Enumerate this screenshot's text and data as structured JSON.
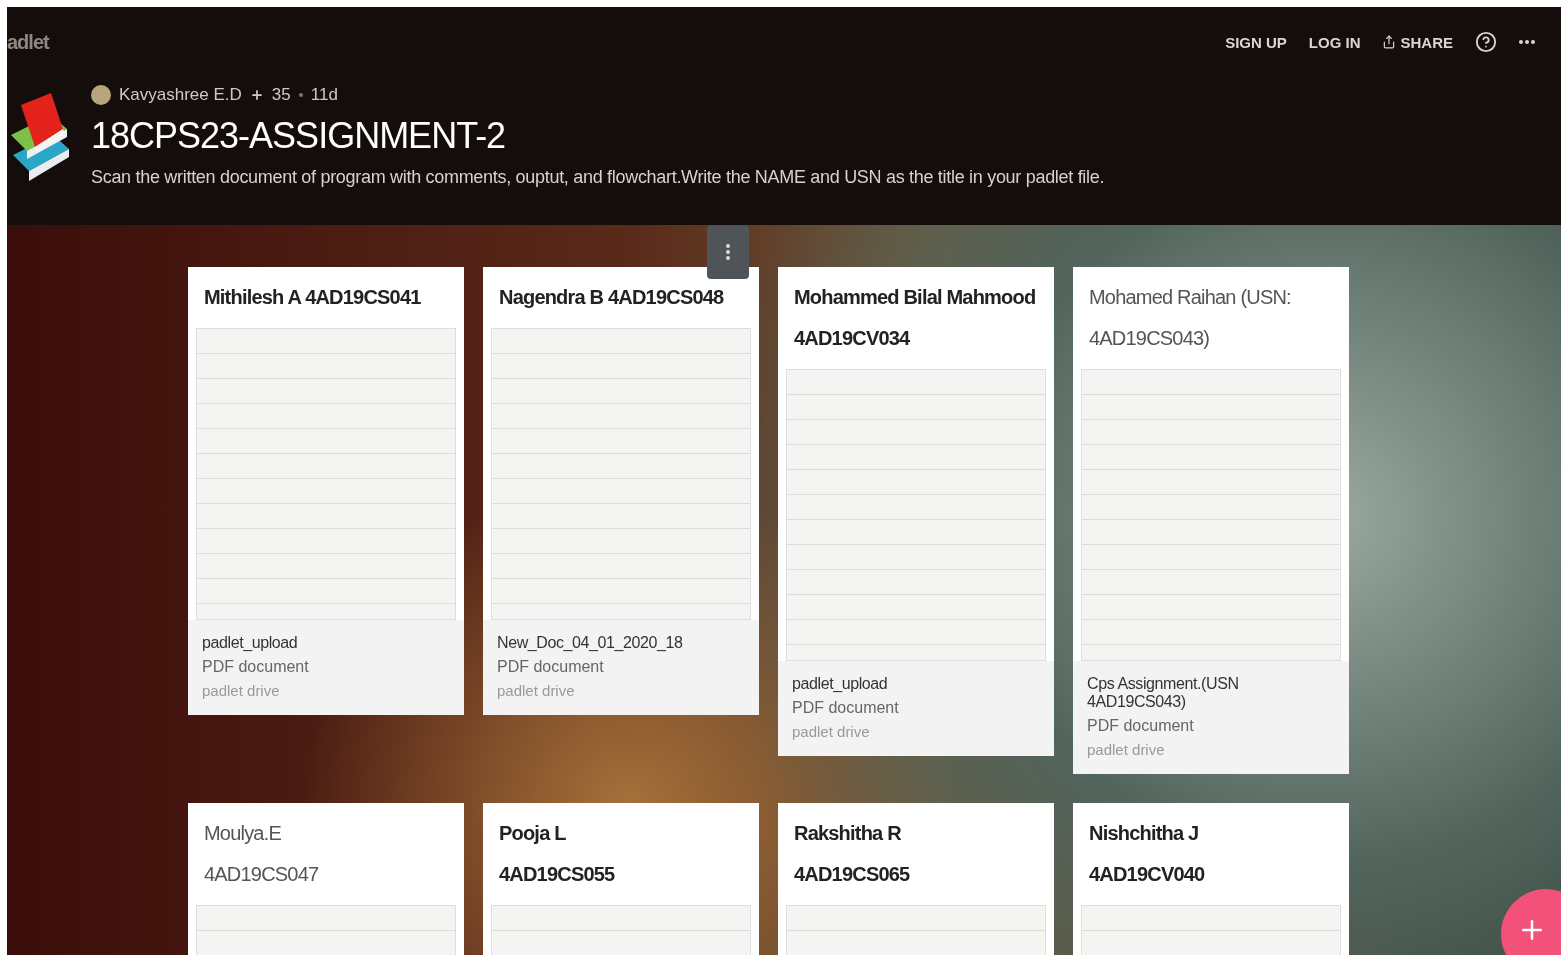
{
  "app": {
    "logo_text": "adlet"
  },
  "header_actions": [
    {
      "kind": "text",
      "label": "SIGN UP"
    },
    {
      "kind": "text",
      "label": "LOG IN"
    },
    {
      "kind": "share",
      "label": "SHARE"
    },
    {
      "kind": "help"
    },
    {
      "kind": "more"
    }
  ],
  "board": {
    "author": "Kavyashree E.D",
    "contributors": "35",
    "age": "11d",
    "title": "18CPS23-ASSIGNMENT-2",
    "description": "Scan the written document of program with comments, ouptut, and flowchart.Write the NAME and USN as the title in your padlet file."
  },
  "posts": [
    {
      "title_lines": [
        "Mithilesh A 4AD19CS041"
      ],
      "light_title": false,
      "options_shown": false,
      "attachment": {
        "name": "padlet_upload",
        "type": "PDF document",
        "source": "padlet drive"
      }
    },
    {
      "title_lines": [
        "Nagendra B 4AD19CS048"
      ],
      "light_title": false,
      "options_shown": true,
      "attachment": {
        "name": "New_Doc_04_01_2020_18",
        "type": "PDF document",
        "source": "padlet drive"
      }
    },
    {
      "title_lines": [
        "Mohammed Bilal Mahmood",
        "4AD19CV034"
      ],
      "light_title": false,
      "options_shown": false,
      "attachment": {
        "name": "padlet_upload",
        "type": "PDF document",
        "source": "padlet drive"
      }
    },
    {
      "title_lines": [
        "Mohamed Raihan  (USN:",
        "4AD19CS043)"
      ],
      "light_title": true,
      "options_shown": false,
      "attachment": {
        "name": "Cps Assignment.(USN 4AD19CS043)",
        "type": "PDF document",
        "source": "padlet drive"
      }
    },
    {
      "title_lines": [
        "Moulya.E",
        "4AD19CS047"
      ],
      "light_title": true,
      "options_shown": false
    },
    {
      "title_lines": [
        "Pooja L",
        "4AD19CS055"
      ],
      "light_title": false,
      "options_shown": false
    },
    {
      "title_lines": [
        "Rakshitha R",
        "4AD19CS065"
      ],
      "light_title": false,
      "options_shown": false
    },
    {
      "title_lines": [
        "Nishchitha J",
        "4AD19CV040"
      ],
      "light_title": false,
      "options_shown": false
    }
  ]
}
